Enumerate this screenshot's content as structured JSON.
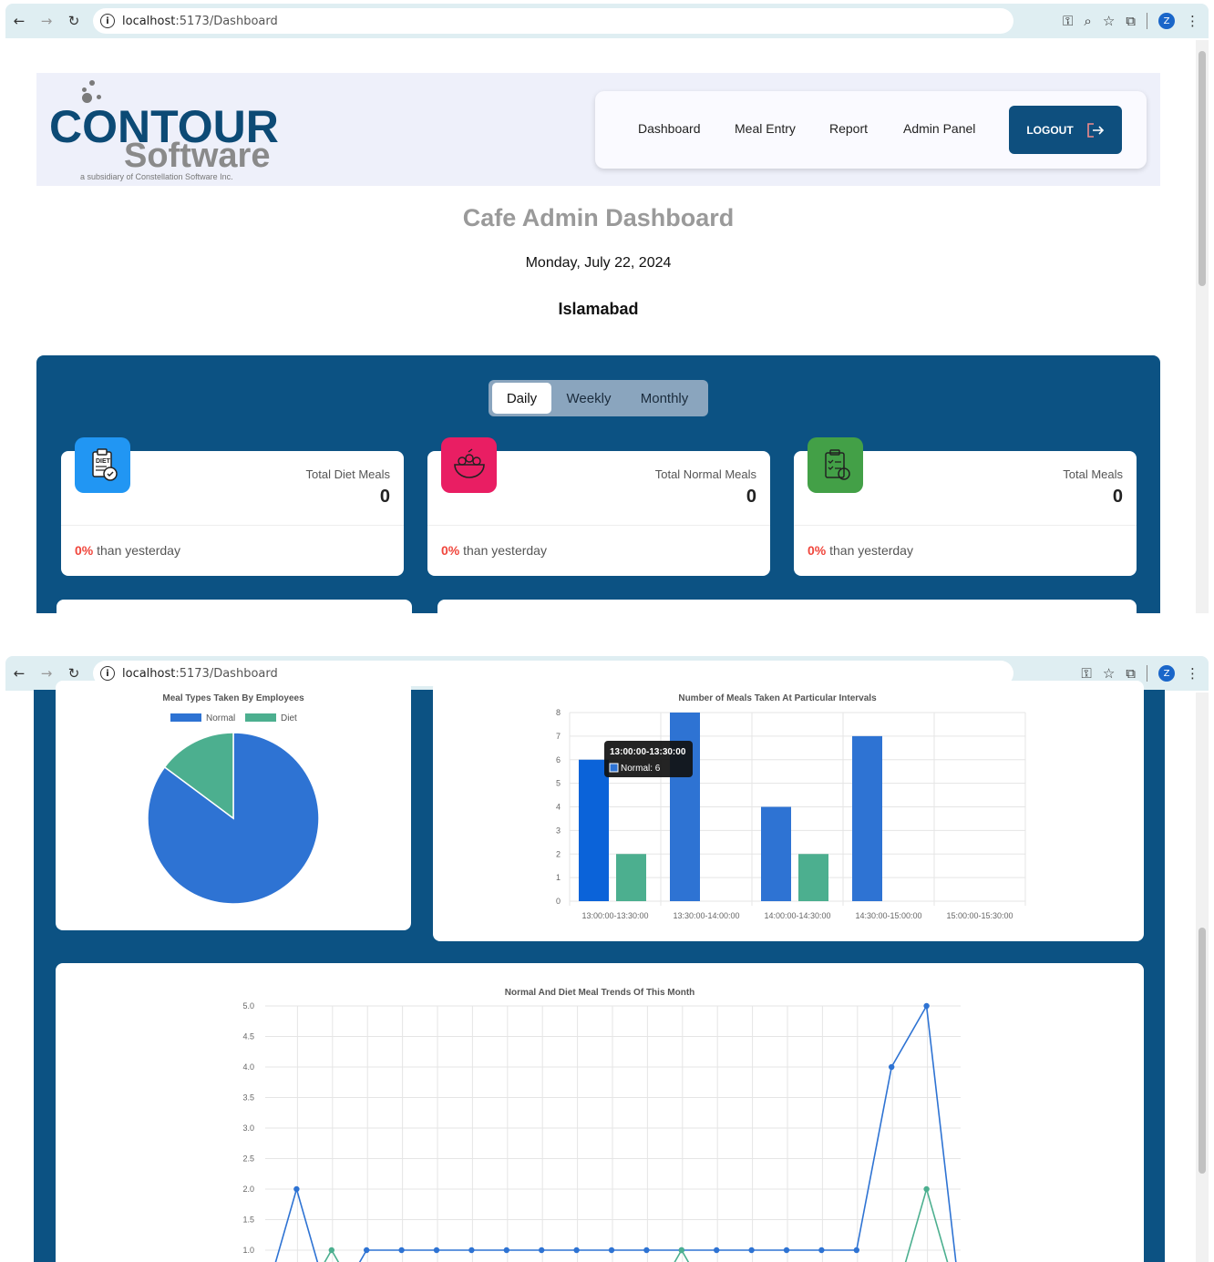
{
  "browser": {
    "url_host": "localhost",
    "url_path": ":5173/Dashboard",
    "avatar_letter": "Z"
  },
  "logo": {
    "brand_top": "CONTOUR",
    "brand_bottom": "Software",
    "tagline": "a subsidiary of Constellation Software Inc."
  },
  "nav": {
    "items": [
      "Dashboard",
      "Meal Entry",
      "Report",
      "Admin Panel"
    ],
    "logout_label": "LOGOUT"
  },
  "page": {
    "title": "Cafe Admin Dashboard",
    "date": "Monday, July 22, 2024",
    "city": "Islamabad"
  },
  "period_toggle": {
    "options": [
      "Daily",
      "Weekly",
      "Monthly"
    ],
    "selected": "Daily"
  },
  "stats": [
    {
      "label": "Total Diet Meals",
      "value": "0",
      "change": "0%",
      "change_suffix": " than yesterday",
      "icon": "diet-clipboard-icon",
      "color": "#2196f3"
    },
    {
      "label": "Total Normal Meals",
      "value": "0",
      "change": "0%",
      "change_suffix": " than yesterday",
      "icon": "salad-bowl-icon",
      "color": "#e91e63"
    },
    {
      "label": "Total Meals",
      "value": "0",
      "change": "0%",
      "change_suffix": " than yesterday",
      "icon": "meal-checklist-icon",
      "color": "#43a047"
    }
  ],
  "colors": {
    "normal": "#2e73d3",
    "diet": "#4caf8f",
    "panel": "#0c5283",
    "accent_red": "#f0463c"
  },
  "chart_data": [
    {
      "type": "pie",
      "title": "Meal Types Taken By Employees",
      "legend": [
        "Normal",
        "Diet"
      ],
      "legend_position": "top",
      "values": [
        23,
        4
      ]
    },
    {
      "type": "bar",
      "title": "Number of Meals Taken At Particular Intervals",
      "categories": [
        "13:00:00-13:30:00",
        "13:30:00-14:00:00",
        "14:00:00-14:30:00",
        "14:30:00-15:00:00",
        "15:00:00-15:30:00"
      ],
      "series": [
        {
          "name": "Normal",
          "values": [
            6,
            8,
            4,
            7,
            0
          ]
        },
        {
          "name": "Diet",
          "values": [
            2,
            0,
            2,
            0,
            0
          ]
        }
      ],
      "ylim": [
        0,
        8
      ],
      "yticks": [
        0,
        1,
        2,
        3,
        4,
        5,
        6,
        7,
        8
      ],
      "grid": true,
      "tooltip": {
        "title": "13:00:00-13:30:00",
        "line": "Normal: 6"
      }
    },
    {
      "type": "line",
      "title": "Normal And Diet Meal Trends Of This Month",
      "yticks": [
        "1.0",
        "1.5",
        "2.0",
        "2.5",
        "3.0",
        "3.5",
        "4.0",
        "4.5",
        "5.0"
      ],
      "ylim_visible": [
        1.0,
        5.0
      ],
      "grid": true,
      "series": [
        {
          "name": "Normal",
          "values": [
            0,
            2,
            0,
            1,
            1,
            1,
            1,
            1,
            1,
            1,
            1,
            1,
            1,
            1,
            1,
            1,
            1,
            1,
            4,
            5,
            0
          ]
        },
        {
          "name": "Diet",
          "values": [
            0,
            0,
            1,
            0,
            0,
            0,
            0,
            0,
            0,
            0,
            0,
            0,
            1,
            0,
            0,
            0,
            0,
            0,
            0,
            2,
            0
          ]
        }
      ]
    }
  ]
}
